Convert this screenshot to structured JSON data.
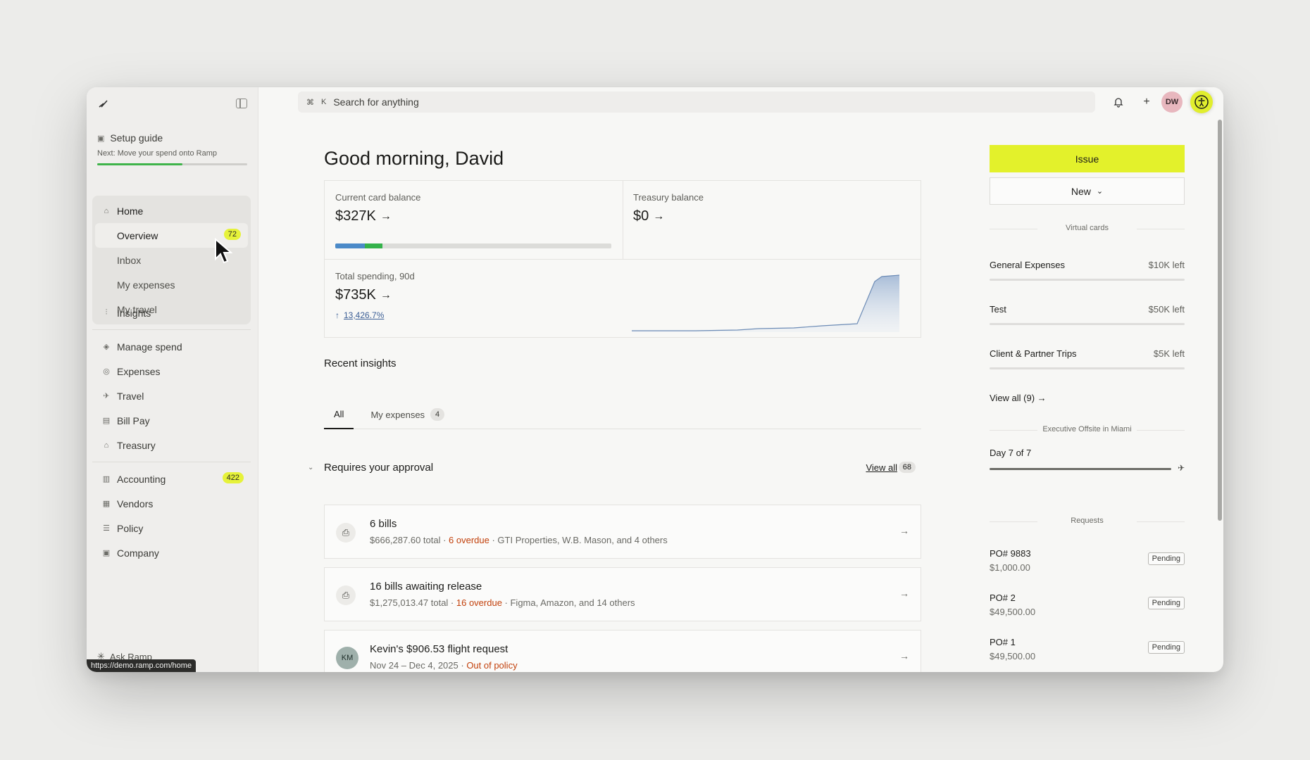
{
  "url_tooltip": "https://demo.ramp.com/home",
  "sidebar": {
    "setup": {
      "label": "Setup guide",
      "next": "Next: Move your spend onto Ramp",
      "progress": 0.57
    },
    "home": {
      "label": "Home"
    },
    "home_items": [
      {
        "label": "Overview",
        "badge": "72"
      },
      {
        "label": "Inbox"
      },
      {
        "label": "My expenses"
      },
      {
        "label": "My travel"
      }
    ],
    "insights": "Insights",
    "spend_items": [
      "Manage spend",
      "Expenses",
      "Travel",
      "Bill Pay",
      "Treasury"
    ],
    "accounting": {
      "label": "Accounting",
      "badge": "422"
    },
    "other_items": [
      "Vendors",
      "Policy",
      "Company"
    ],
    "ask": "Ask Ramp"
  },
  "topbar": {
    "kbd1": "⌘",
    "kbd2": "K",
    "search_placeholder": "Search for anything",
    "avatar": "DW"
  },
  "main": {
    "greeting": "Good morning, David",
    "card_balance": {
      "label": "Current card balance",
      "value": "$327K"
    },
    "treasury": {
      "label": "Treasury balance",
      "value": "$0"
    },
    "spending": {
      "label": "Total spending, 90d",
      "value": "$735K",
      "change": "13,426.7%"
    },
    "recent_insights": "Recent insights",
    "tabs": [
      {
        "label": "All"
      },
      {
        "label": "My expenses",
        "count": "4"
      }
    ],
    "approval": {
      "title": "Requires your approval",
      "view_all": "View all",
      "count": "68"
    },
    "cards": [
      {
        "title": "6 bills",
        "pre": "$666,287.60 total · ",
        "red": "6 overdue",
        "post": " · GTI Properties, W.B. Mason, and 4 others"
      },
      {
        "title": "16 bills awaiting release",
        "pre": "$1,275,013.47 total · ",
        "red": "16 overdue",
        "post": " · Figma, Amazon, and 14 others"
      },
      {
        "title": "Kevin's $906.53 flight request",
        "initials": "KM",
        "pre": "Nov 24 – Dec 4, 2025 · ",
        "red": "Out of policy",
        "post": ""
      }
    ]
  },
  "right": {
    "issue": "Issue",
    "new": "New",
    "virtual_cards_label": "Virtual cards",
    "virtual_cards": [
      {
        "name": "General Expenses",
        "left": "$10K left"
      },
      {
        "name": "Test",
        "left": "$50K left"
      },
      {
        "name": "Client & Partner Trips",
        "left": "$5K left"
      }
    ],
    "view_all": "View all (9) →",
    "trip_label": "Executive Offsite in Miami",
    "trip_day": "Day 7 of 7",
    "requests_label": "Requests",
    "requests": [
      {
        "name": "PO# 9883",
        "amount": "$1,000.00",
        "status": "Pending"
      },
      {
        "name": "PO# 2",
        "amount": "$49,500.00",
        "status": "Pending"
      },
      {
        "name": "PO# 1",
        "amount": "$49,500.00",
        "status": "Pending"
      }
    ]
  },
  "colors": {
    "accent_yellow": "#e3f12b",
    "overdue_red": "#c2410c",
    "progress_green": "#3fb44a",
    "bar_blue": "#4b8ac8"
  }
}
